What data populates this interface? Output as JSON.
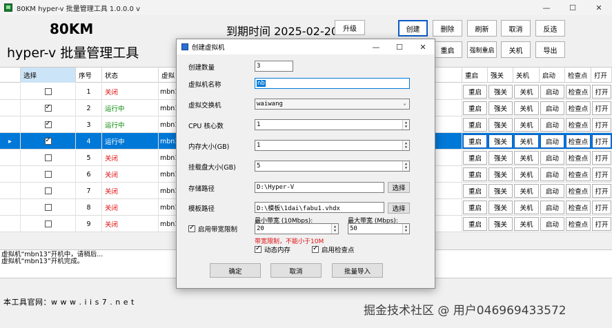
{
  "window": {
    "title": "80KM hyper-v 批量管理工具 1.0.0.0 v",
    "minimize": "—",
    "maximize": "☐",
    "close": "✕"
  },
  "header": {
    "brand": "80KM",
    "subtitle": "hyper-v 批量管理工具",
    "expire": "到期时间 2025-02-20"
  },
  "toolbar": {
    "upgrade": "升级",
    "create": "创建",
    "delete": "删除",
    "refresh": "刷新",
    "cancel": "取消",
    "invert": "反选",
    "restart": "重启",
    "force_restart": "强制重启",
    "shutdown": "关机",
    "export": "导出"
  },
  "grid": {
    "columns": {
      "select": "选择",
      "index": "序号",
      "status": "状态",
      "name": "虚拟",
      "restart": "重启",
      "force_off": "强关",
      "shutdown": "关机",
      "start": "启动",
      "checkpoint": "检查点",
      "open": "打开"
    },
    "row_button_labels": {
      "restart": "重启",
      "force_off": "强关",
      "shutdown": "关机",
      "start": "启动",
      "checkpoint": "检查点",
      "open": "打开"
    },
    "current_marker": "▸",
    "rows": [
      {
        "checked": false,
        "index": "1",
        "status": "关闭",
        "state": "off",
        "name": "mbn10"
      },
      {
        "checked": true,
        "index": "2",
        "status": "运行中",
        "state": "on",
        "name": "mbn11"
      },
      {
        "checked": true,
        "index": "3",
        "status": "运行中",
        "state": "on",
        "name": "mbn12"
      },
      {
        "checked": true,
        "index": "4",
        "status": "运行中",
        "state": "on",
        "name": "mbn13",
        "selected": true
      },
      {
        "checked": false,
        "index": "5",
        "status": "关闭",
        "state": "off",
        "name": "mbn15"
      },
      {
        "checked": false,
        "index": "6",
        "status": "关闭",
        "state": "off",
        "name": "mbn16"
      },
      {
        "checked": false,
        "index": "7",
        "status": "关闭",
        "state": "off",
        "name": "mbn17"
      },
      {
        "checked": false,
        "index": "8",
        "status": "关闭",
        "state": "off",
        "name": "mbn18"
      },
      {
        "checked": false,
        "index": "9",
        "status": "关闭",
        "state": "off",
        "name": "mbn19"
      }
    ]
  },
  "log": {
    "line1": "虚拟机“mbn13”开机中，请稍后...",
    "line2": "虚拟机“mbn13”开机完成。"
  },
  "footer": {
    "site": "本工具官网：w w w . i i s 7 . n e t",
    "watermark": "掘金技术社区 @ 用户046969433572"
  },
  "dialog": {
    "title": "创建虚拟机",
    "minimize": "—",
    "maximize": "☐",
    "close": "✕",
    "count_label": "创建数量",
    "count_value": "3",
    "name_label": "虚拟机名称",
    "name_value": "nb",
    "switch_label": "虚拟交换机",
    "switch_value": "waiwang",
    "cpu_label": "CPU 核心数",
    "cpu_value": "1",
    "memory_label": "内存大小(GB)",
    "memory_value": "1",
    "disk_label": "挂载盘大小(GB)",
    "disk_value": "5",
    "storage_label": "存储路径",
    "storage_value": "D:\\Hyper-V",
    "template_label": "模板路径",
    "template_value": "D:\\模板\\1dai\\fabu1.vhdx",
    "choose": "选择",
    "bw_limit_label": "启用带宽限制",
    "min_bw_label": "最小带宽 (10Mbps):",
    "min_bw_value": "20",
    "max_bw_label": "最大带宽 (Mbps):",
    "max_bw_value": "50",
    "bw_warning": "带宽限制，不能小于10M",
    "dynamic_mem": "动态内存",
    "enable_checkpoint": "启用检查点",
    "ok": "确定",
    "cancel": "取消",
    "batch_import": "批量导入"
  }
}
